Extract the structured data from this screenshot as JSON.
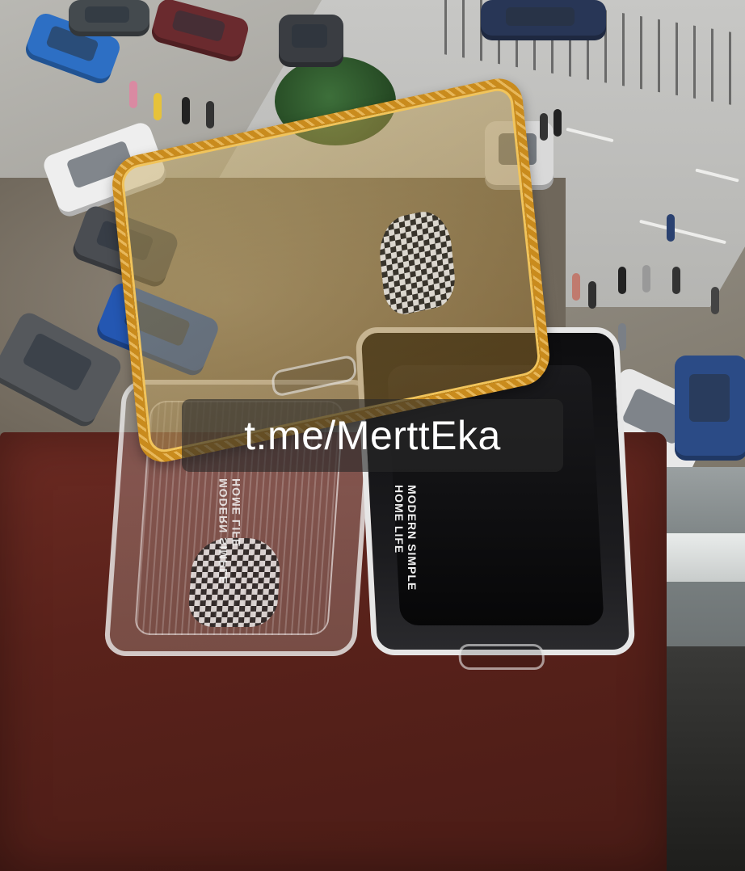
{
  "watermark": {
    "text": "t.me/MerttEka"
  },
  "products": {
    "black_tray_print": [
      "MODERN SIMPLE",
      "HOME LIFE"
    ],
    "clear_tray_print": [
      "MODERN SIMPLE",
      "HOME LIFE"
    ]
  },
  "colors": {
    "gold_tray": "#c98b1d",
    "black_tray": "#111113",
    "board": "#5a221b",
    "watermark_bg": "#2a2a2a"
  }
}
